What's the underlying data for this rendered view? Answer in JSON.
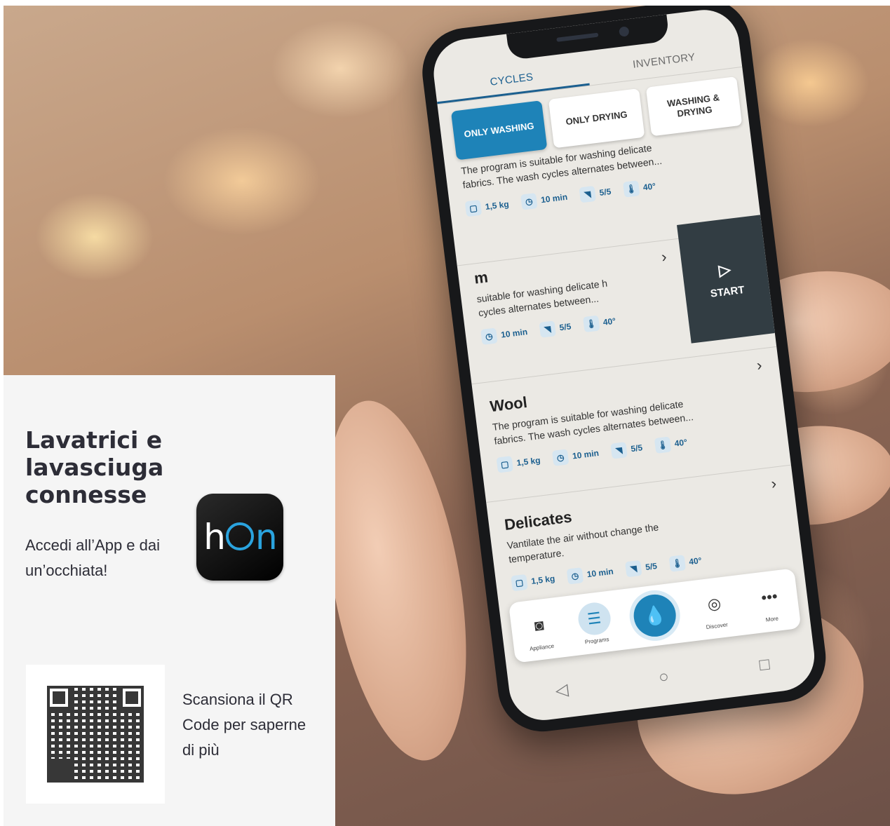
{
  "panel": {
    "headline": "Lavatrici e lavasciuga connesse",
    "subtext": "Accedi all’App e dai un’occhiata!",
    "qr_text": "Scansiona il QR Code per saperne di più",
    "app_logo": {
      "h": "h",
      "n": "n"
    }
  },
  "app": {
    "tabs": [
      {
        "label": "CYCLES",
        "active": true
      },
      {
        "label": "INVENTORY",
        "active": false
      }
    ],
    "filters": [
      {
        "label": "ONLY WASHING",
        "active": true
      },
      {
        "label": "ONLY DRYING",
        "active": false
      },
      {
        "label": "WASHING & DRYING",
        "active": false
      }
    ],
    "programs": [
      {
        "name": "",
        "description": "The program is suitable for washing delicate fabrics. The wash cycles alternates between...",
        "weight": "1,5 kg",
        "time": "10 min",
        "level": "5/5",
        "temp": "40°"
      },
      {
        "name": "m",
        "description": "suitable for washing delicate h cycles alternates between...",
        "weight": "",
        "time": "10 min",
        "level": "5/5",
        "temp": "40°"
      },
      {
        "name": "Wool",
        "description": "The program is suitable for washing delicate fabrics. The wash cycles alternates between...",
        "weight": "1,5 kg",
        "time": "10 min",
        "level": "5/5",
        "temp": "40°"
      },
      {
        "name": "Delicates",
        "description": "Vantilate the air without change the temperature.",
        "weight": "1,5 kg",
        "time": "10 min",
        "level": "5/5",
        "temp": "40°"
      }
    ],
    "start_label": "START",
    "nav": [
      {
        "label": "Appliance",
        "icon": "washer-icon"
      },
      {
        "label": "Programs",
        "icon": "list-icon"
      },
      {
        "label": "",
        "icon": "drop-icon"
      },
      {
        "label": "Discover",
        "icon": "compass-icon"
      },
      {
        "label": "More",
        "icon": "more-icon"
      }
    ],
    "colors": {
      "accent": "#1e83b8",
      "start_bg": "#323d43"
    }
  }
}
